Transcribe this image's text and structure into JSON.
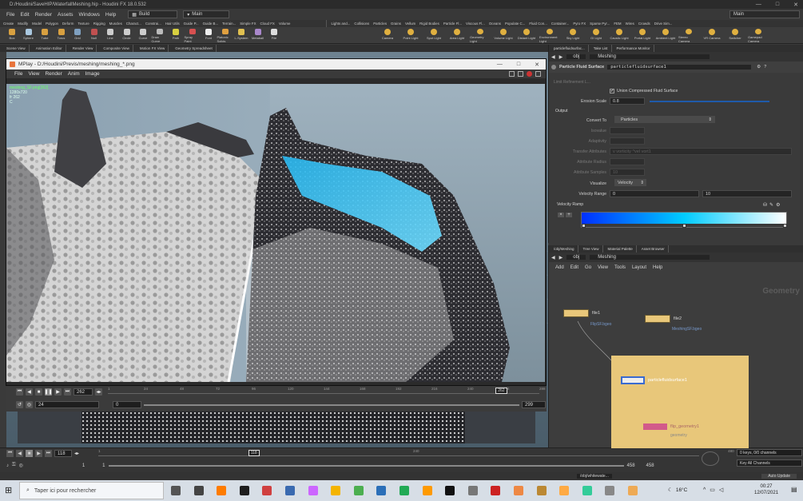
{
  "titlebar": {
    "title": "D:/Houdini/SaveHIP/WaterfallMeshing.hip - Houdini FX 18.0.532",
    "controls": [
      "—",
      "□",
      "✕"
    ]
  },
  "menubar": {
    "items": [
      "File",
      "Edit",
      "Render",
      "Assets",
      "Windows",
      "Help"
    ],
    "desktop": "Build",
    "desktop2": "Main",
    "right": "Main"
  },
  "shelf_tabs_left": [
    "Create",
    "Modify",
    "Model",
    "Polygon",
    "Deform",
    "Texture",
    "Rigging",
    "Muscles",
    "Charact...",
    "Constrai...",
    "Hair Utils",
    "Guide P...",
    "Guide B...",
    "Terrain...",
    "Simple FX",
    "Cloud FX",
    "Volume"
  ],
  "shelf_tabs_right": [
    "Lights and...",
    "Collisions",
    "Particles",
    "Grains",
    "Vellum",
    "Rigid Bodies",
    "Particle Fl...",
    "Viscous Fl...",
    "Oceans",
    "Populate C...",
    "Fluid Con...",
    "Container...",
    "Pyro FX",
    "Sparse Pyr...",
    "FEM",
    "Wires",
    "Crowds",
    "Drive Sim..."
  ],
  "shelf_tools_left": [
    "Box",
    "Sphere",
    "Tube",
    "Torus",
    "Grid",
    "Null",
    "Line",
    "Circle",
    "Curve",
    "Draw Curve",
    "Path",
    "Spray Paint",
    "Font",
    "Platonic Solids",
    "L-System",
    "Metaball",
    "File"
  ],
  "shelf_tools_right": [
    "Camera",
    "Point Light",
    "Spot Light",
    "Area Light",
    "Geometry Light",
    "Volume Light",
    "Distant Light",
    "Environment Light",
    "Sky Light",
    "GI Light",
    "Caustic Light",
    "Portal Light",
    "Ambient Light",
    "Stereo Camera",
    "VR Camera",
    "Switcher",
    "Gamepad Camera"
  ],
  "pane_tabs_left": [
    "Scene View",
    "Animation Editor",
    "Render View",
    "Composite View",
    "Motion FX View",
    "Geometry Spreadsheet"
  ],
  "pane_tabs_right": [
    "particlefluidsurfac...",
    "Take List",
    "Performance Monitor"
  ],
  "mplay": {
    "title": "MPlay - D:/Houdini/Previs/meshing/meshing_*.png",
    "menu": [
      "File",
      "View",
      "Render",
      "Anim",
      "Image"
    ],
    "overlay": [
      "meshing_SF.png[262]",
      "1280x720",
      "fr 262",
      "C"
    ]
  },
  "playbar": {
    "frame": "262",
    "marker": "262",
    "ticks": [
      "1",
      "24",
      "48",
      "72",
      "96",
      "120",
      "144",
      "168",
      "192",
      "216",
      "240",
      "264",
      "288"
    ],
    "step": "24",
    "start": "0",
    "end": "299"
  },
  "params": {
    "path_obj": "obj",
    "path_node": "Meshing",
    "node_type": "Particle Fluid Surface",
    "node_name": "particlefluidsurface1",
    "limit_refinement": "Limit Refinement L...",
    "union_compressed": "Union Compressed Fluid Surface",
    "erosion_scale_label": "Erosion Scale",
    "erosion_scale": "0.8",
    "output_label": "Output",
    "convert_to_label": "Convert To",
    "convert_to": "Particles",
    "isovalue_label": "Isovalue",
    "adaptivity_label": "Adaptivity",
    "transfer_attr_label": "Transfer Attributes",
    "transfer_attr_value": "v vorticity ^vel vort1",
    "attr_radius_label": "Attribute Radius",
    "attr_samples_label": "Attribute Samples",
    "attr_samples": "10",
    "visualize_label": "Visualize",
    "visualize": "Velocity",
    "velocity_range_label": "Velocity Range",
    "vel_min": "0",
    "vel_max": "10",
    "velocity_ramp_label": "Velocity Ramp"
  },
  "network": {
    "tabs": [
      "/obj/Meshing",
      "Tree View",
      "Material Palette",
      "Asset Browser"
    ],
    "path_obj": "obj",
    "path_node": "Meshing",
    "menu": [
      "Add",
      "Edit",
      "Go",
      "View",
      "Tools",
      "Layout",
      "Help"
    ],
    "context_label": "Geometry",
    "nodes": [
      {
        "name": "file1",
        "sub": "FlipSF.bgeo"
      },
      {
        "name": "file2",
        "sub": "MeshingSF.bgeo"
      },
      {
        "name": "particlefluidsurface1",
        "sub": ""
      },
      {
        "name": "flip_geometry1",
        "sub": "geometry"
      }
    ]
  },
  "timeline": {
    "frame": "118",
    "marker": "118",
    "ticks": [
      "1",
      "240",
      "480"
    ],
    "start": "1",
    "start2": "1",
    "end": "458",
    "end2": "458",
    "keys": "0 keys, 0/0 channels",
    "all_channels": "Key All Channels",
    "auto_update": "Auto Update",
    "status_path": "/obj/whitewate..."
  },
  "taskbar": {
    "search_placeholder": "Taper ici pour rechercher",
    "weather": "16°C",
    "time": "00:27",
    "date": "12/07/2021"
  },
  "colors": {
    "accent": "#e8a43c",
    "ramp_start": "#0030ff",
    "ramp_mid": "#00ccff",
    "ramp_end": "#ffffff",
    "node_yellow": "#e8c77a"
  }
}
